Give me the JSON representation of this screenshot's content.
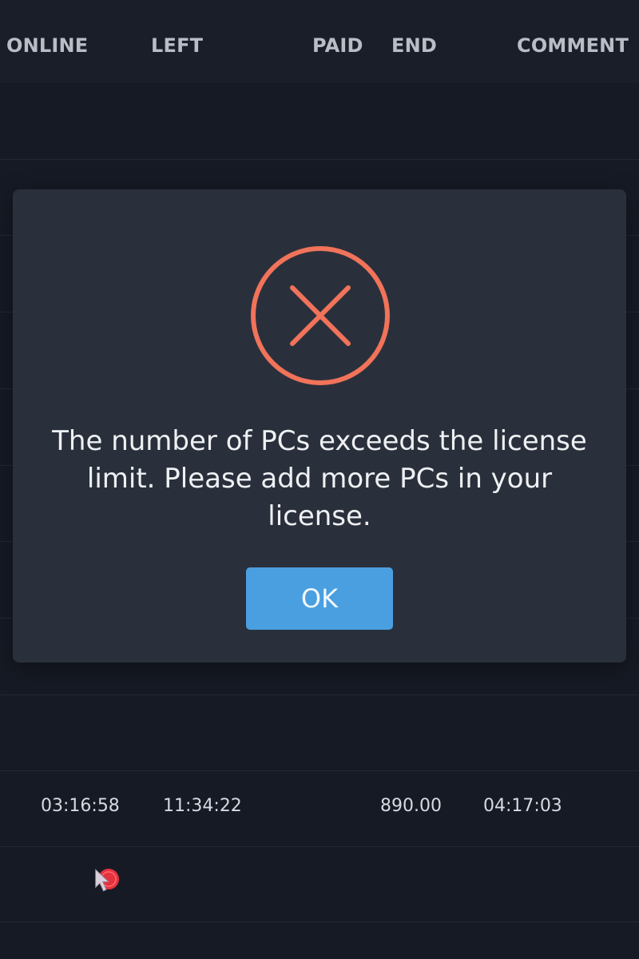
{
  "table": {
    "headers": [
      "ONLINE",
      "LEFT",
      "PAID",
      "END",
      "COMMENT"
    ],
    "row": {
      "online": "03:16:58",
      "left": "11:34:22",
      "paid": "890.00",
      "end": "04:17:03"
    }
  },
  "dialog": {
    "icon": "error-x-circle-icon",
    "message": "The number of PCs exceeds the license limit. Please add more PCs in your license.",
    "ok_label": "OK"
  },
  "colors": {
    "background": "#161a24",
    "dialog_background": "#2a303b",
    "error_accent": "#f0735a",
    "button_primary": "#4a9fe0",
    "cursor_click": "#e5323e"
  }
}
